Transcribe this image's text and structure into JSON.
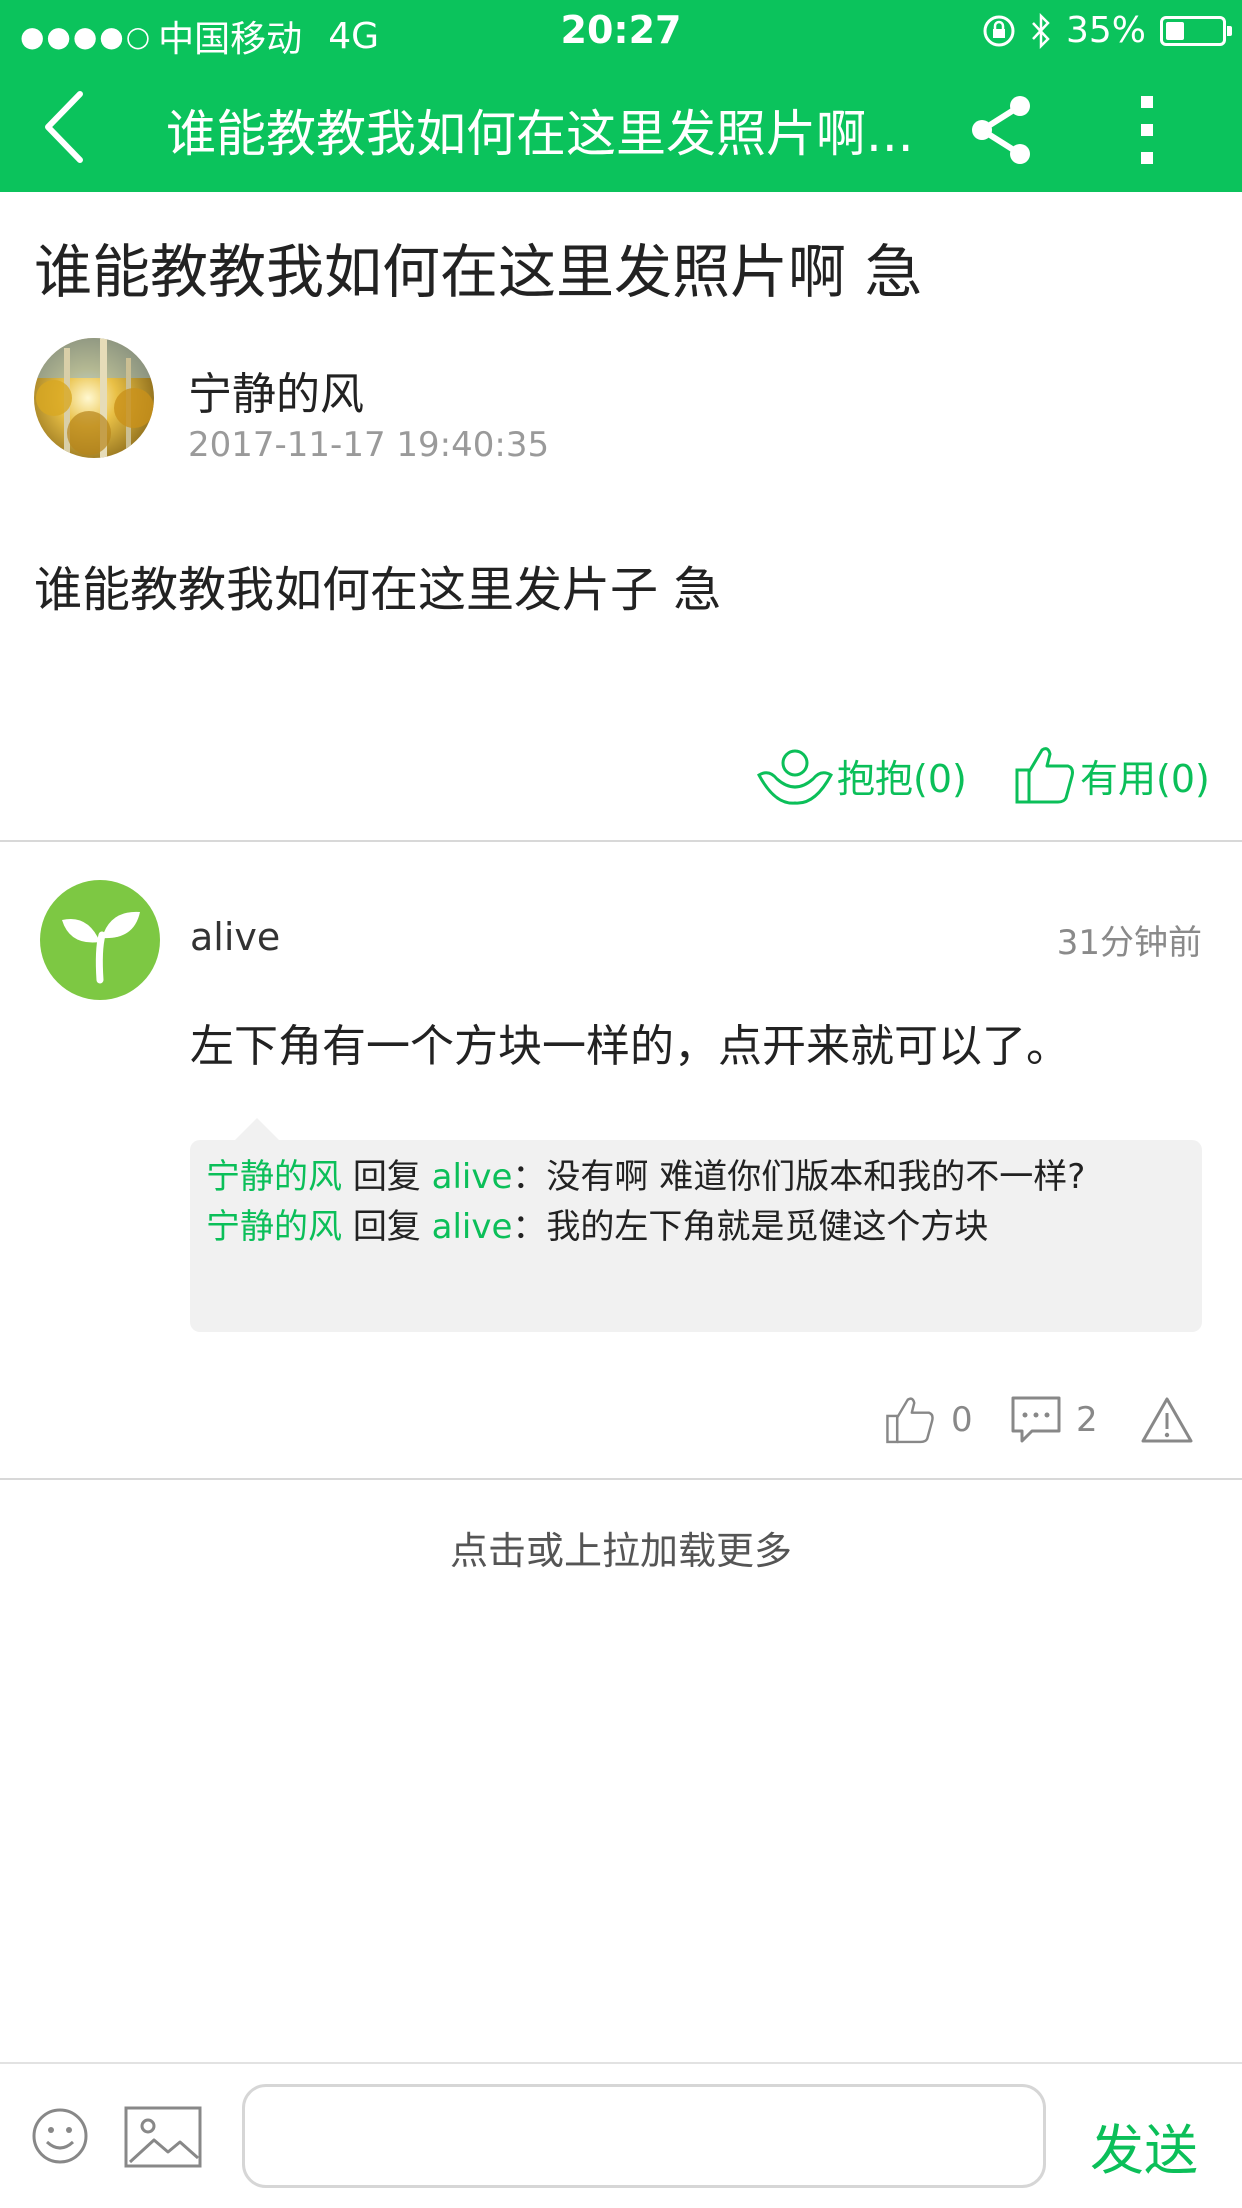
{
  "status_bar": {
    "signal": "●●●●○",
    "carrier": "中国移动",
    "network": "4G",
    "time": "20:27",
    "battery": "35%"
  },
  "nav": {
    "title": "谁能教教我如何在这里发照片啊...",
    "accent_color": "#0bc35c"
  },
  "post": {
    "title": "谁能教教我如何在这里发照片啊 急",
    "author": "宁静的风",
    "time": "2017-11-17 19:40:35",
    "body": "谁能教教我如何在这里发片子 急",
    "hug_label": "抱抱(0)",
    "useful_label": "有用(0)"
  },
  "comment": {
    "author": "alive",
    "time": "31分钟前",
    "body": "左下角有一个方块一样的，点开来就可以了。",
    "replies": [
      {
        "from": "宁静的风",
        "verb": "回复",
        "to": "alive",
        "text": "：没有啊 难道你们版本和我的不一样?"
      },
      {
        "from": "宁静的风",
        "verb": "回复",
        "to": "alive",
        "text": "：我的左下角就是觅健这个方块"
      }
    ],
    "like_count": "0",
    "comment_count": "2"
  },
  "load_more": "点击或上拉加载更多",
  "composer": {
    "placeholder": "",
    "send_label": "发送"
  }
}
